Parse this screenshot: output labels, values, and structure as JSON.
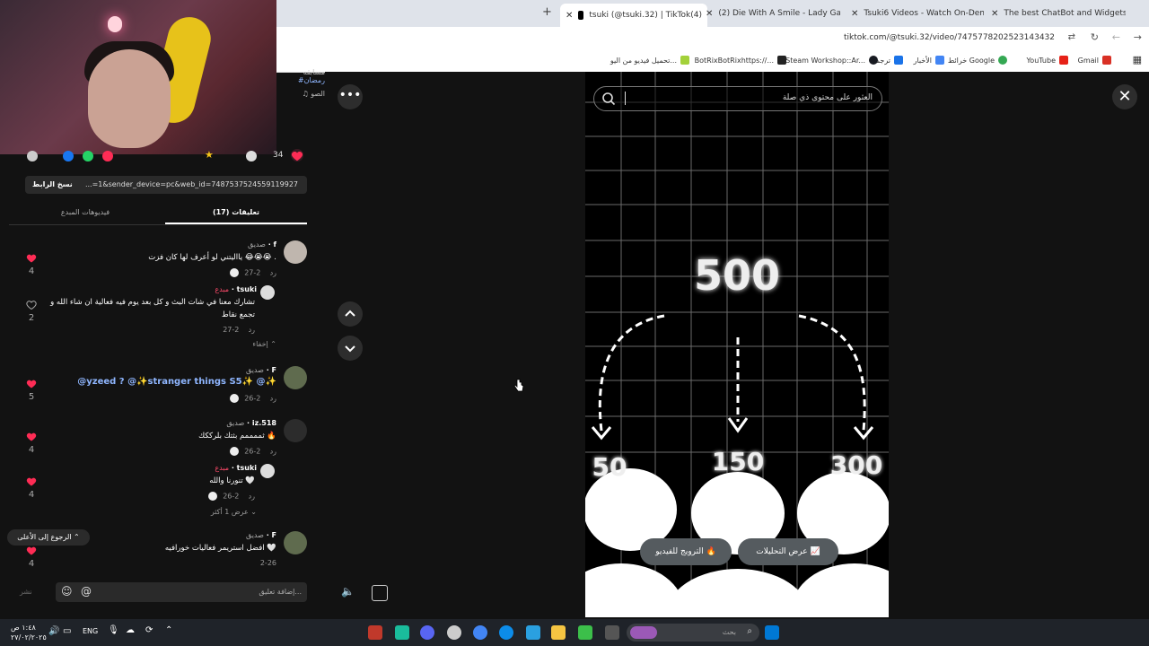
{
  "browser": {
    "tabs": [
      {
        "title": "tsuki (@tsuki.32) | TikTok(4)",
        "active": true
      },
      {
        "title": "(2) Die With A Smile - Lady Gag"
      },
      {
        "title": "Tsuki6 Videos - Watch On-Dem"
      },
      {
        "title": "The best ChatBot and Widgets"
      }
    ],
    "new_tab": "+",
    "url": "tiktok.com/@tsuki.32/video/7475778202523143432",
    "bookmarks": [
      "Gmail",
      "YouTube",
      "خرائط Google",
      "الأخبار",
      "ترجمة",
      "Steam Workshop::Ar...",
      "BotRixBotRixhttps://...",
      "تحميل فيديو من اليو..."
    ]
  },
  "panel": {
    "top_fragment_lines": [
      "مسابقه",
      "#رمضان",
      "♫ الصو"
    ],
    "reaction_count": "34",
    "copy_link_label": "نسخ الرابط",
    "link_text": "...=1&sender_device=pc&web_id=7487537524559119927",
    "tab_comments": "(17) تعليقات",
    "tab_creator_videos": "فيديوهات المبدع",
    "comments": [
      {
        "user": "f",
        "role": "صديق",
        "text": "يااليتني لو أعرف لها كان فزت 😂😭😭 .",
        "date": "2-27",
        "reply": "رد",
        "likes": "4",
        "liked": true
      },
      {
        "user": "tsuki",
        "role": "مبدع",
        "text1": "تشارك معنا في شات البث و كل بعد يوم فيه فعالية ان شاء الله و",
        "text2": "تجمع نقاط",
        "date": "2-27",
        "reply": "رد",
        "likes": "2",
        "liked": false,
        "hide_label": "إخفاء"
      },
      {
        "user": "F",
        "role": "صديق",
        "text": "@yzeed ? @✨stranger things S5✨ @✨",
        "date": "2-26",
        "reply": "رد",
        "likes": "5",
        "liked": true
      },
      {
        "user": "iz.518",
        "role": "صديق",
        "text": "ثممممم بثتك بلرككك 🔥",
        "date": "2-26",
        "reply": "رد",
        "likes": "4",
        "liked": true
      },
      {
        "user": "tsuki",
        "role": "مبدع",
        "text": "تنورنا والله 🤍",
        "date": "2-26",
        "reply": "رد",
        "likes": "4",
        "liked": true,
        "more_label": "عرض 1 أكثر"
      },
      {
        "user": "F",
        "role": "صديق",
        "text": "افضل استريمر فعاليات خورافيه 🤍",
        "date": "2-26",
        "likes": "4",
        "liked": true
      }
    ],
    "back_to_top": "الرجوع إلى الأعلى",
    "comment_placeholder": "إضافة تعليق...",
    "post_label": "نشر"
  },
  "video": {
    "search_placeholder": "العثور على محتوى ذي صلة",
    "close_symbol": "✕",
    "more_symbol": "•••",
    "numbers": {
      "top": "500",
      "left": "50",
      "middle": "150",
      "right": "300"
    },
    "view_analytics": "عرض التحليلات",
    "promote_video": "الترويج للفيديو"
  },
  "taskbar": {
    "time": "١:٤٨ ص",
    "date": "٢٧/٠٢/٢٠٢٥",
    "lang": "ENG",
    "search_placeholder": "بحث"
  }
}
